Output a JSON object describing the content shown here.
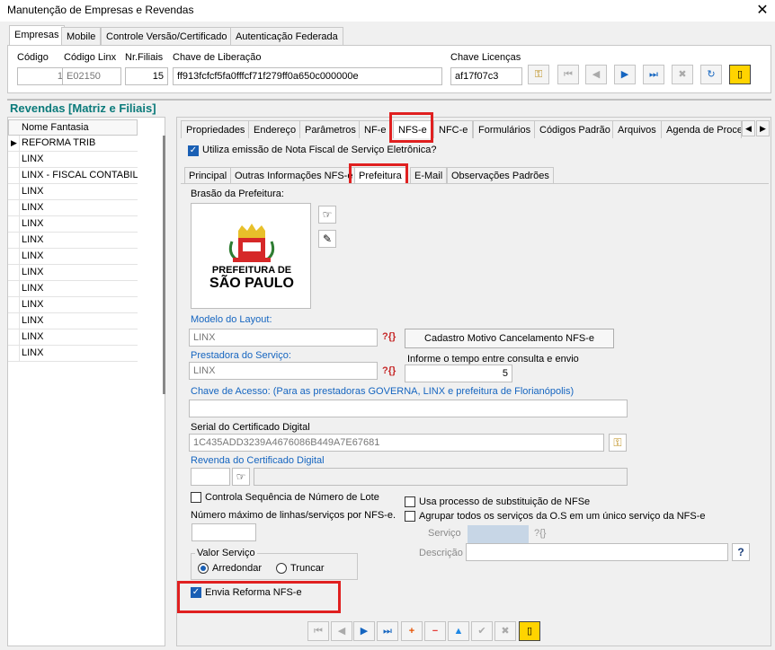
{
  "window": {
    "title": "Manutenção de Empresas e Revendas",
    "close_glyph": "✕"
  },
  "top_tabs": [
    "Empresas",
    "Mobile",
    "Controle Versão/Certificado",
    "Autenticação Federada"
  ],
  "header": {
    "codigo_label": "Código",
    "codigo_value": "1",
    "codigo_linx_label": "Código Linx",
    "codigo_linx_value": "E02150",
    "nr_filiais_label": "Nr.Filiais",
    "nr_filiais_value": "15",
    "chave_liberacao_label": "Chave de Liberação",
    "chave_liberacao_value": "ff913fcfcf5fa0fffcf71f279ff0a650c000000e",
    "chave_licencas_label": "Chave Licenças",
    "chave_licencas_value": "af17f07c3"
  },
  "revendas_title": "Revendas [Matriz e Filiais]",
  "list": {
    "header": "Nome Fantasia",
    "rows": [
      "REFORMA TRIB",
      "LINX",
      "LINX - FISCAL CONTABIL -",
      "LINX",
      "LINX",
      "LINX",
      "LINX",
      "LINX",
      "LINX",
      "LINX",
      "LINX",
      "LINX",
      "LINX",
      "LINX"
    ]
  },
  "main_tabs": [
    "Propriedades",
    "Endereço",
    "Parâmetros",
    "NF-e",
    "NFS-e",
    "NFC-e",
    "Formulários",
    "Códigos Padrão",
    "Arquivos",
    "Agenda de Proces"
  ],
  "utiliza_nfse_label": "Utiliza emissão de Nota Fiscal de Serviço Eletrônica?",
  "sub_tabs": [
    "Principal",
    "Outras Informações NFS-e",
    "Prefeitura",
    "E-Mail",
    "Observações Padrões"
  ],
  "prefeitura": {
    "brasao_label": "Brasão da Prefeitura:",
    "logo_line1": "PREFEITURA DE",
    "logo_line2": "SÃO PAULO",
    "modelo_layout_label": "Modelo do Layout:",
    "modelo_layout_value": "LINX",
    "cadastro_motivo_button": "Cadastro Motivo Cancelamento NFS-e",
    "prestadora_label": "Prestadora do Serviço:",
    "prestadora_value": "LINX",
    "tempo_label": "Informe o tempo entre consulta e envio",
    "tempo_value": "5",
    "chave_acesso_label": "Chave de Acesso: (Para as prestadoras GOVERNA, LINX e prefeitura de Florianópolis)",
    "chave_acesso_value": "",
    "serial_label": "Serial do Certificado Digital",
    "serial_value": "1C435ADD3239A4676086B449A7E67681",
    "revenda_cert_label": "Revenda do Certificado Digital",
    "controla_lote_label": "Controla Sequência de Número de Lote",
    "numero_max_label": "Número máximo de linhas/serviços por NFS-e.",
    "usa_substituicao_label": "Usa processo de substituição de NFSe",
    "agrupar_label": "Agrupar todos os serviços da O.S em um único serviço da NFS-e",
    "servico_label": "Serviço",
    "descricao_label": "Descrição",
    "valor_servico_label": "Valor Serviço",
    "arredondar_label": "Arredondar",
    "truncar_label": "Truncar",
    "envia_reforma_label": "Envia Reforma NFS-e"
  },
  "help_glyph": "?{}",
  "colors": {
    "accent_blue": "#1565c0",
    "highlight_red": "#e02020",
    "title_teal": "#0a7a7a"
  }
}
